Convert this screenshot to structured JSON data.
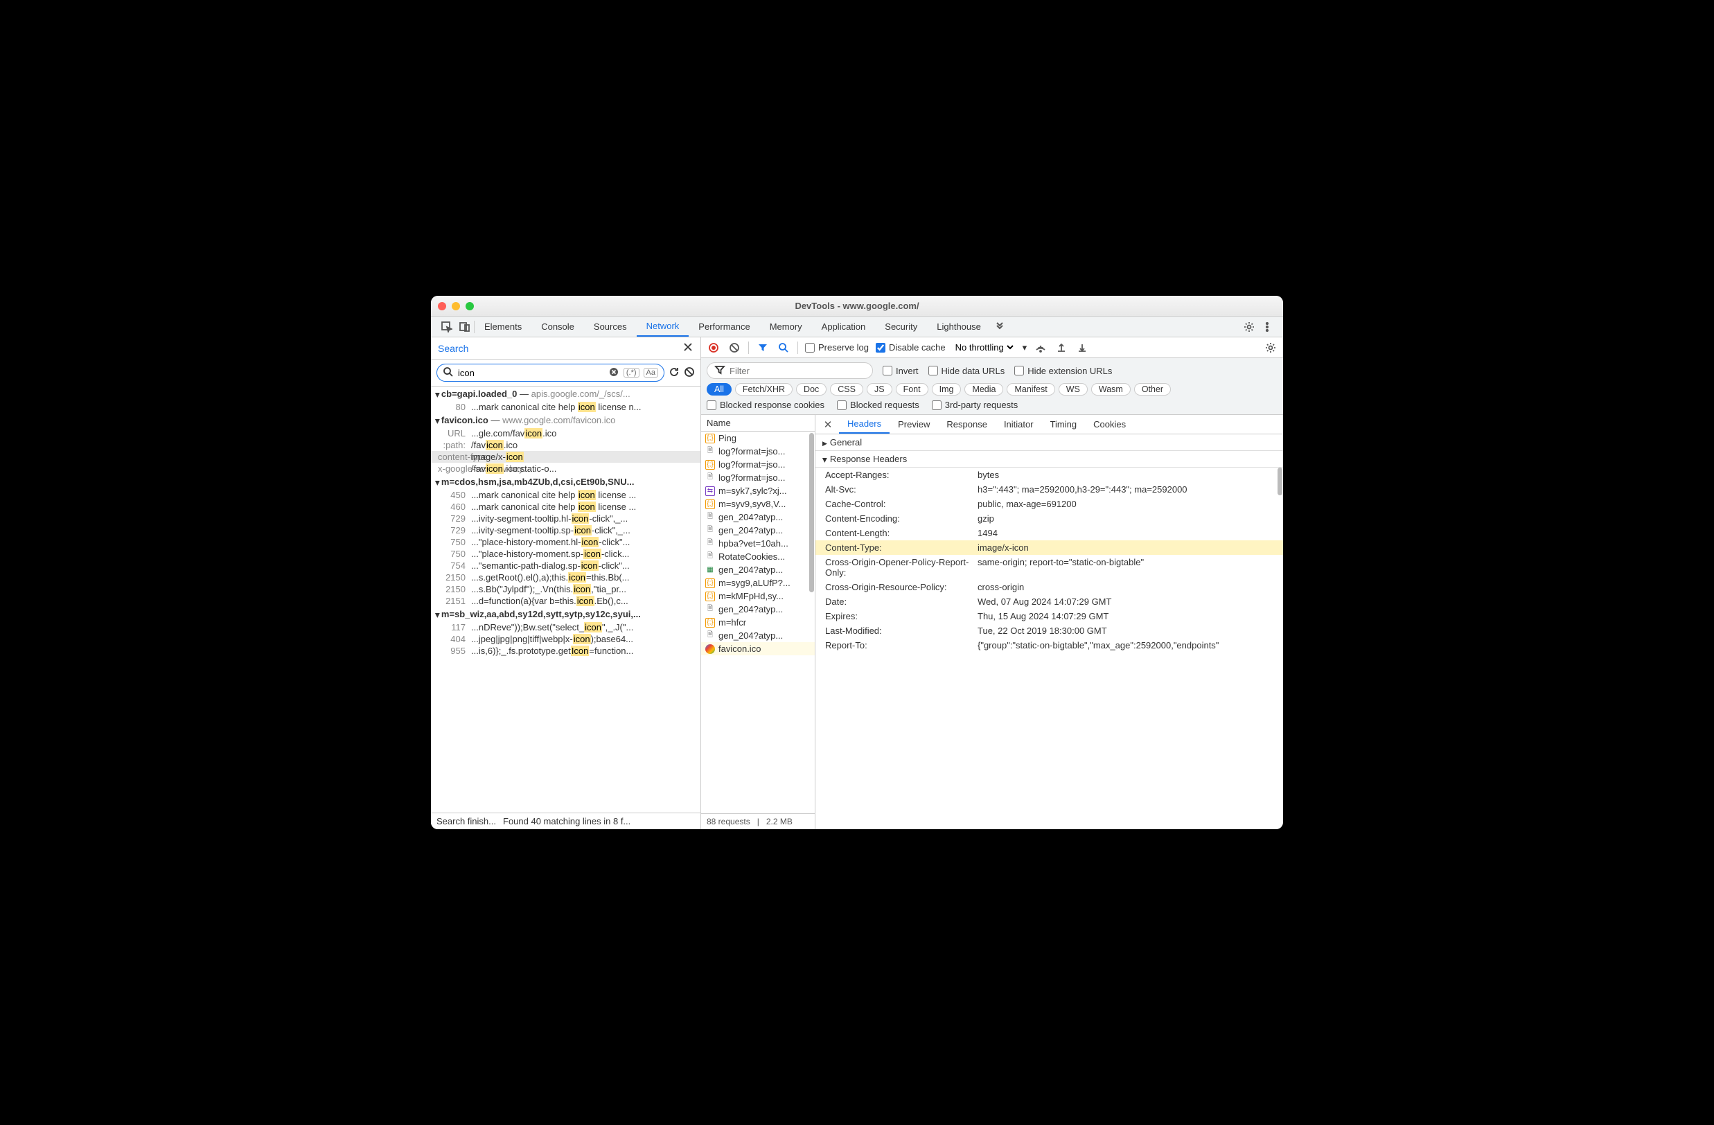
{
  "window": {
    "title": "DevTools - www.google.com/"
  },
  "panels": [
    "Elements",
    "Console",
    "Sources",
    "Network",
    "Performance",
    "Memory",
    "Application",
    "Security",
    "Lighthouse"
  ],
  "activePanel": "Network",
  "search": {
    "label": "Search",
    "query": "icon",
    "regexChip": "(.*)",
    "caseChip": "Aa"
  },
  "searchResults": [
    {
      "file": "cb=gapi.loaded_0",
      "path": "apis.google.com/_/scs/...",
      "matches": [
        {
          "line": "80",
          "pre": "...mark canonical cite help ",
          "hl": "icon",
          "post": " license n..."
        }
      ]
    },
    {
      "file": "favicon.ico",
      "path": "www.google.com/favicon.ico",
      "matches": [
        {
          "line": "URL",
          "pre": "...gle.com/fav",
          "hl": "icon",
          "post": ".ico"
        },
        {
          "line": ":path:",
          "pre": "/fav",
          "hl": "icon",
          "post": ".ico"
        },
        {
          "line": "content-type:",
          "pre": "image/x-",
          "hl": "icon",
          "post": "",
          "selected": true
        },
        {
          "line": "x-google-scs-row-key:",
          "pre": "/fav",
          "hl": "icon",
          "post": ".ico:static-o..."
        }
      ]
    },
    {
      "file": "m=cdos,hsm,jsa,mb4ZUb,d,csi,cEt90b,SNU...",
      "path": "",
      "matches": [
        {
          "line": "450",
          "pre": "...mark canonical cite help ",
          "hl": "icon",
          "post": " license ..."
        },
        {
          "line": "460",
          "pre": "...mark canonical cite help ",
          "hl": "icon",
          "post": " license ..."
        },
        {
          "line": "729",
          "pre": "...ivity-segment-tooltip.hl-",
          "hl": "icon",
          "post": "-click\",_..."
        },
        {
          "line": "729",
          "pre": "...ivity-segment-tooltip.sp-",
          "hl": "icon",
          "post": "-click\",_..."
        },
        {
          "line": "750",
          "pre": "...\"place-history-moment.hl-",
          "hl": "icon",
          "post": "-click\"..."
        },
        {
          "line": "750",
          "pre": "...\"place-history-moment.sp-",
          "hl": "icon",
          "post": "-click..."
        },
        {
          "line": "754",
          "pre": "...\"semantic-path-dialog.sp-",
          "hl": "icon",
          "post": "-click\"..."
        },
        {
          "line": "2150",
          "pre": "...s.getRoot().el(),a);this.",
          "hl": "icon",
          "post": "=this.Bb(..."
        },
        {
          "line": "2150",
          "pre": "...s.Bb(\"Jylpdf\");_.Vn(this.",
          "hl": "icon",
          "post": ",\"tia_pr..."
        },
        {
          "line": "2151",
          "pre": "...d=function(a){var b=this.",
          "hl": "icon",
          "post": ".Eb(),c..."
        }
      ]
    },
    {
      "file": "m=sb_wiz,aa,abd,sy12d,sytt,sytp,sy12c,syui,...",
      "path": "",
      "matches": [
        {
          "line": "117",
          "pre": "...nDReve\"));Bw.set(\"select_",
          "hl": "icon",
          "post": "\",_.J(\"..."
        },
        {
          "line": "404",
          "pre": "...jpeg|jpg|png|tiff|webp|x-",
          "hl": "icon",
          "post": ");base64..."
        },
        {
          "line": "955",
          "pre": "...is,6)};_.fs.prototype.get",
          "hl": "Icon",
          "post": "=function..."
        }
      ]
    }
  ],
  "searchStatus": {
    "left": "Search finish...",
    "right": "Found 40 matching lines in 8 f..."
  },
  "toolbar": {
    "preserve": "Preserve log",
    "disable": "Disable cache",
    "throttle": "No throttling"
  },
  "filterBar": {
    "placeholder": "Filter",
    "invert": "Invert",
    "hideData": "Hide data URLs",
    "hideExt": "Hide extension URLs",
    "chips": [
      "All",
      "Fetch/XHR",
      "Doc",
      "CSS",
      "JS",
      "Font",
      "Img",
      "Media",
      "Manifest",
      "WS",
      "Wasm",
      "Other"
    ],
    "blockedCookies": "Blocked response cookies",
    "blockedReq": "Blocked requests",
    "thirdParty": "3rd-party requests"
  },
  "requestList": {
    "header": "Name",
    "items": [
      {
        "name": "Ping",
        "kind": "script"
      },
      {
        "name": "log?format=jso...",
        "kind": "doc"
      },
      {
        "name": "log?format=jso...",
        "kind": "script"
      },
      {
        "name": "log?format=jso...",
        "kind": "doc"
      },
      {
        "name": "m=syk7,sylc?xj...",
        "kind": "xhr"
      },
      {
        "name": "m=syv9,syv8,V...",
        "kind": "script"
      },
      {
        "name": "gen_204?atyp...",
        "kind": "doc"
      },
      {
        "name": "gen_204?atyp...",
        "kind": "doc"
      },
      {
        "name": "hpba?vet=10ah...",
        "kind": "doc"
      },
      {
        "name": "RotateCookies...",
        "kind": "doc"
      },
      {
        "name": "gen_204?atyp...",
        "kind": "img"
      },
      {
        "name": "m=syg9,aLUfP?...",
        "kind": "script"
      },
      {
        "name": "m=kMFpHd,sy...",
        "kind": "script"
      },
      {
        "name": "gen_204?atyp...",
        "kind": "doc"
      },
      {
        "name": "m=hfcr",
        "kind": "script"
      },
      {
        "name": "gen_204?atyp...",
        "kind": "doc"
      },
      {
        "name": "favicon.ico",
        "kind": "fav",
        "selected": true
      }
    ],
    "footer": {
      "count": "88 requests",
      "size": "2.2 MB"
    }
  },
  "detailTabs": [
    "Headers",
    "Preview",
    "Response",
    "Initiator",
    "Timing",
    "Cookies"
  ],
  "activeDetail": "Headers",
  "generalLabel": "General",
  "responseHeadersLabel": "Response Headers",
  "headers": [
    {
      "k": "Accept-Ranges:",
      "v": "bytes"
    },
    {
      "k": "Alt-Svc:",
      "v": "h3=\":443\"; ma=2592000,h3-29=\":443\"; ma=2592000"
    },
    {
      "k": "Cache-Control:",
      "v": "public, max-age=691200"
    },
    {
      "k": "Content-Encoding:",
      "v": "gzip"
    },
    {
      "k": "Content-Length:",
      "v": "1494"
    },
    {
      "k": "Content-Type:",
      "v": "image/x-icon",
      "hl": true
    },
    {
      "k": "Cross-Origin-Opener-Policy-Report-Only:",
      "v": "same-origin; report-to=\"static-on-bigtable\""
    },
    {
      "k": "Cross-Origin-Resource-Policy:",
      "v": "cross-origin"
    },
    {
      "k": "Date:",
      "v": "Wed, 07 Aug 2024 14:07:29 GMT"
    },
    {
      "k": "Expires:",
      "v": "Thu, 15 Aug 2024 14:07:29 GMT"
    },
    {
      "k": "Last-Modified:",
      "v": "Tue, 22 Oct 2019 18:30:00 GMT"
    },
    {
      "k": "Report-To:",
      "v": "{\"group\":\"static-on-bigtable\",\"max_age\":2592000,\"endpoints\""
    }
  ]
}
